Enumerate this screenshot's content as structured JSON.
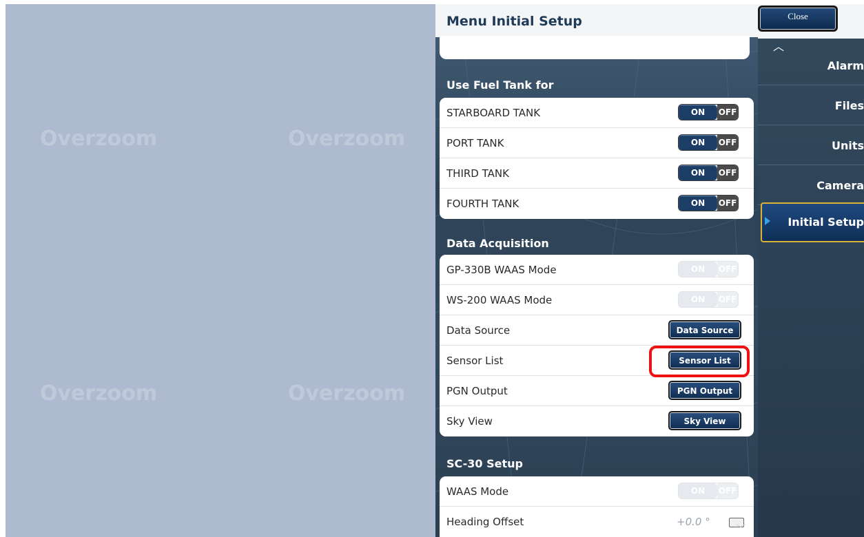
{
  "map": {
    "watermark": "Overzoom"
  },
  "menu": {
    "title": "Menu Initial Setup",
    "sections": {
      "fuel": {
        "title": "Use Fuel Tank for",
        "rows": [
          {
            "label": "STARBOARD TANK",
            "on": "ON",
            "off": "OFF"
          },
          {
            "label": "PORT TANK",
            "on": "ON",
            "off": "OFF"
          },
          {
            "label": "THIRD TANK",
            "on": "ON",
            "off": "OFF"
          },
          {
            "label": "FOURTH TANK",
            "on": "ON",
            "off": "OFF"
          }
        ]
      },
      "data": {
        "title": "Data Acquisition",
        "rows": [
          {
            "label": "GP-330B WAAS Mode",
            "on": "ON",
            "off": "OFF"
          },
          {
            "label": "WS-200 WAAS Mode",
            "on": "ON",
            "off": "OFF"
          },
          {
            "label": "Data Source",
            "button": "Data Source"
          },
          {
            "label": "Sensor List",
            "button": "Sensor List"
          },
          {
            "label": "PGN Output",
            "button": "PGN Output"
          },
          {
            "label": "Sky View",
            "button": "Sky View"
          }
        ]
      },
      "sc30": {
        "title": "SC-30 Setup",
        "rows": [
          {
            "label": "WAAS Mode",
            "on": "ON",
            "off": "OFF"
          },
          {
            "label": "Heading Offset",
            "value": "+0.0 °"
          }
        ]
      }
    }
  },
  "sidebar": {
    "close_label": "Close",
    "items": [
      {
        "label": "Alarm"
      },
      {
        "label": "Files"
      },
      {
        "label": "Units"
      },
      {
        "label": "Camera"
      },
      {
        "label": "Initial Setup",
        "active": true
      }
    ]
  },
  "colors": {
    "accent": "#1c3d66",
    "highlight": "#ee1111",
    "active_border": "#d9b236"
  }
}
